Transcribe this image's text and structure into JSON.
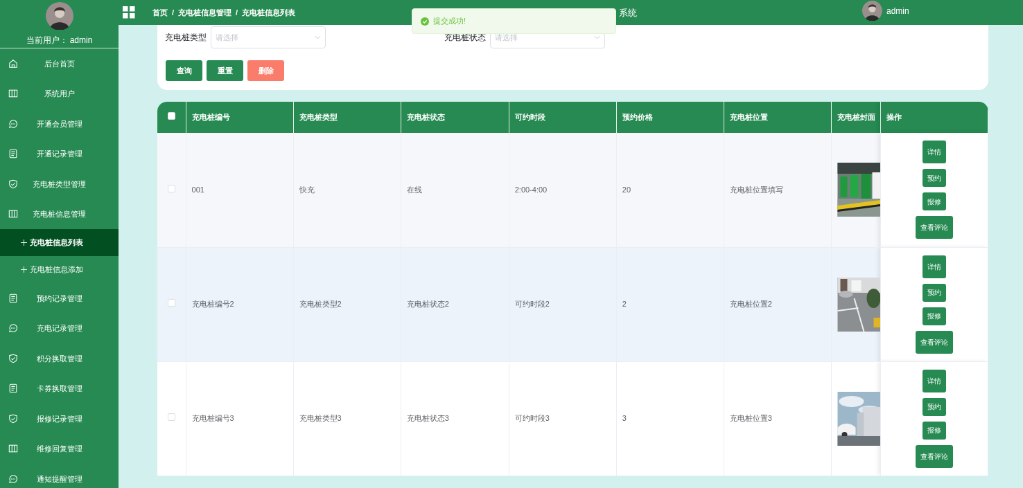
{
  "sidebar": {
    "user_label": "当前用户：",
    "user_name": "admin",
    "items": [
      {
        "label": "后台首页",
        "selected": false
      },
      {
        "label": "系统用户",
        "selected": false
      },
      {
        "label": "开通会员管理",
        "selected": false
      },
      {
        "label": "开通记录管理",
        "selected": false
      },
      {
        "label": "充电桩类型管理",
        "selected": false
      },
      {
        "label": "充电桩信息管理",
        "selected": false,
        "expanded": true,
        "children": [
          {
            "label": "充电桩信息列表",
            "selected": true
          },
          {
            "label": "充电桩信息添加",
            "selected": false
          }
        ]
      },
      {
        "label": "预约记录管理",
        "selected": false
      },
      {
        "label": "充电记录管理",
        "selected": false
      },
      {
        "label": "积分换取管理",
        "selected": false
      },
      {
        "label": "卡券换取管理",
        "selected": false
      },
      {
        "label": "报修记录管理",
        "selected": false
      },
      {
        "label": "维修回复管理",
        "selected": false
      },
      {
        "label": "通知提醒管理",
        "selected": false
      }
    ]
  },
  "header": {
    "breadcrumb": [
      "首页",
      "充电桩信息管理",
      "充电桩信息列表"
    ],
    "separator": "/",
    "title": "系统",
    "user_name": "admin"
  },
  "toast": {
    "text": "提交成功!"
  },
  "filters": [
    {
      "label": "充电桩类型",
      "placeholder": "请选择"
    },
    {
      "label": "充电桩状态",
      "placeholder": "请选择"
    }
  ],
  "filter_buttons": [
    {
      "label": "查询",
      "kind": "primary"
    },
    {
      "label": "重置",
      "kind": "primary"
    },
    {
      "label": "删除",
      "kind": "danger"
    }
  ],
  "table": {
    "select_all_checked": false,
    "columns": [
      "充电桩编号",
      "充电桩类型",
      "充电桩状态",
      "可约时段",
      "预约价格",
      "充电桩位置",
      "充电桩封面",
      "操作"
    ],
    "rows": [
      {
        "cells": [
          "001",
          "快充",
          "在线",
          "2:00-4:00",
          "20",
          "充电桩位置填写"
        ],
        "checked": false,
        "color": "#f5f7fa",
        "actions": [
          "详情",
          "预约",
          "报修",
          "查看评论"
        ]
      },
      {
        "cells": [
          "充电桩编号2",
          "充电桩类型2",
          "充电桩状态2",
          "可约时段2",
          "2",
          "充电桩位置2"
        ],
        "checked": false,
        "color": "#ecf3fb",
        "actions": [
          "详情",
          "预约",
          "报修",
          "查看评论"
        ]
      },
      {
        "cells": [
          "充电桩编号3",
          "充电桩类型3",
          "充电桩状态3",
          "可约时段3",
          "3",
          "充电桩位置3"
        ],
        "checked": false,
        "color": "#ffffff",
        "actions": [
          "详情",
          "预约",
          "报修",
          "查看评论"
        ]
      }
    ]
  }
}
